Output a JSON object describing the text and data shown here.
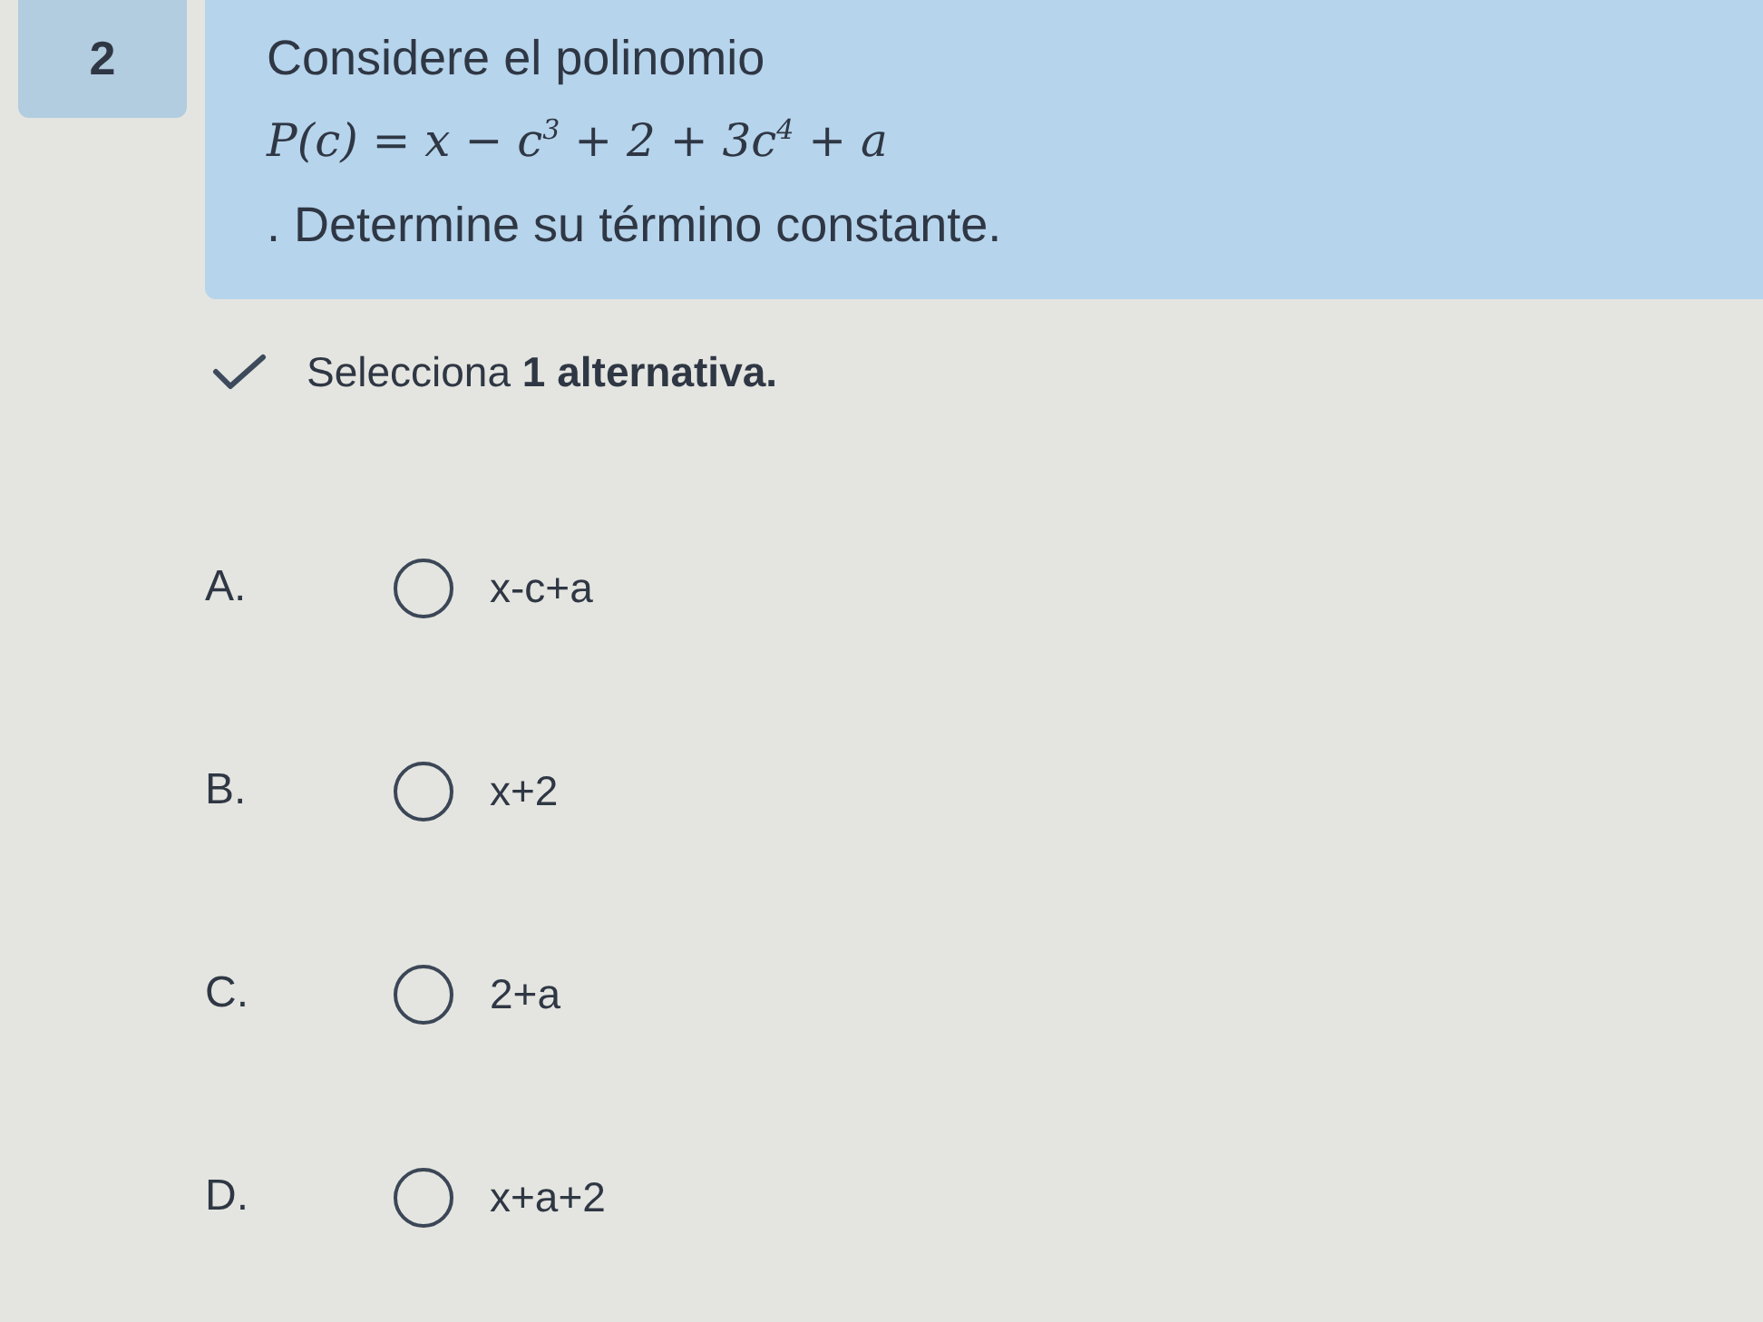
{
  "question": {
    "number": "2",
    "lines": [
      {
        "kind": "text",
        "text": "Considere el polinomio"
      },
      {
        "kind": "formula",
        "text": "P(c) = x − c$^{3}$ + 2 + 3c$^{4}$ + a"
      },
      {
        "kind": "text",
        "text": ". Determine su término constante."
      }
    ]
  },
  "instruction": {
    "text": "Selecciona **1 alternativa.**"
  },
  "options": [
    {
      "letter": "A.",
      "text": "x-c+a",
      "selected": false
    },
    {
      "letter": "B.",
      "text": "x+2",
      "selected": false
    },
    {
      "letter": "C.",
      "text": "2+a",
      "selected": false
    },
    {
      "letter": "D.",
      "text": "x+a+2",
      "selected": false
    }
  ]
}
